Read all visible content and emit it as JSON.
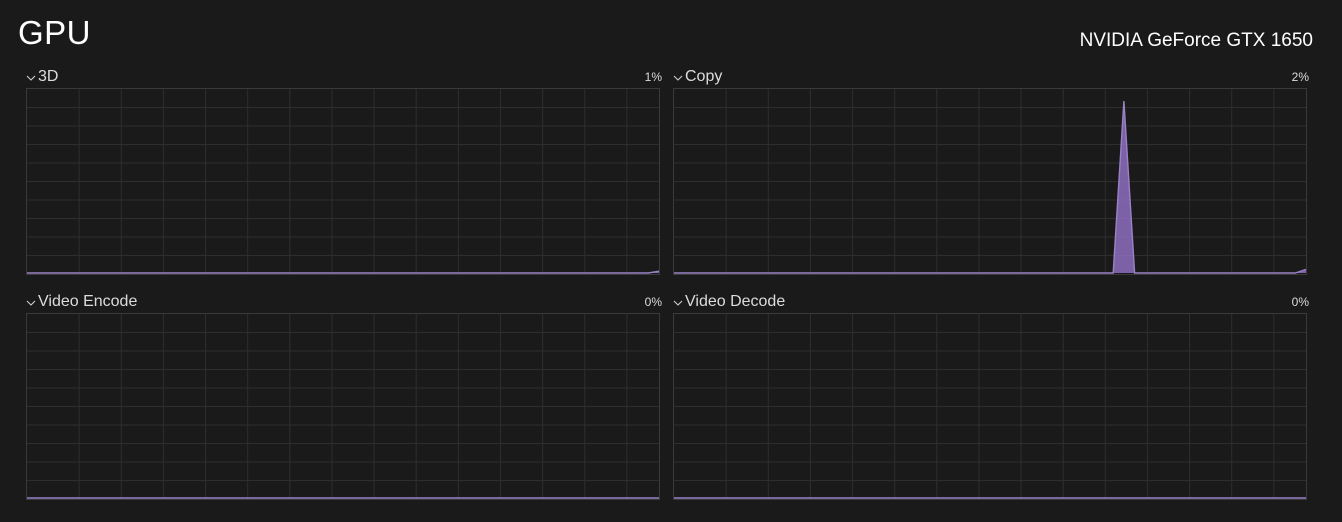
{
  "header": {
    "title": "GPU",
    "device_name": "NVIDIA GeForce GTX 1650"
  },
  "engines": [
    {
      "label": "3D",
      "value": "1%",
      "utilization": [
        0,
        0,
        0,
        0,
        0,
        0,
        0,
        0,
        0,
        0,
        0,
        0,
        0,
        0,
        0,
        0,
        0,
        0,
        0,
        0,
        0,
        0,
        0,
        0,
        0,
        0,
        0,
        0,
        0,
        0,
        0,
        0,
        0,
        0,
        0,
        0,
        0,
        0,
        0,
        0,
        0,
        0,
        0,
        0,
        0,
        0,
        0,
        0,
        0,
        0,
        0,
        0,
        0,
        0,
        0,
        0,
        0,
        0,
        0,
        1
      ]
    },
    {
      "label": "Copy",
      "value": "2%",
      "utilization": [
        0,
        0,
        0,
        0,
        0,
        0,
        0,
        0,
        0,
        0,
        0,
        0,
        0,
        0,
        0,
        0,
        0,
        0,
        0,
        0,
        0,
        0,
        0,
        0,
        0,
        0,
        0,
        0,
        0,
        0,
        0,
        0,
        0,
        0,
        0,
        0,
        0,
        0,
        0,
        0,
        0,
        0,
        95,
        0,
        0,
        0,
        0,
        0,
        0,
        0,
        0,
        0,
        0,
        0,
        0,
        0,
        0,
        0,
        0,
        2
      ]
    },
    {
      "label": "Video Encode",
      "value": "0%",
      "utilization": [
        0,
        0,
        0,
        0,
        0,
        0,
        0,
        0,
        0,
        0,
        0,
        0,
        0,
        0,
        0,
        0,
        0,
        0,
        0,
        0,
        0,
        0,
        0,
        0,
        0,
        0,
        0,
        0,
        0,
        0,
        0,
        0,
        0,
        0,
        0,
        0,
        0,
        0,
        0,
        0,
        0,
        0,
        0,
        0,
        0,
        0,
        0,
        0,
        0,
        0,
        0,
        0,
        0,
        0,
        0,
        0,
        0,
        0,
        0,
        0
      ]
    },
    {
      "label": "Video Decode",
      "value": "0%",
      "utilization": [
        0,
        0,
        0,
        0,
        0,
        0,
        0,
        0,
        0,
        0,
        0,
        0,
        0,
        0,
        0,
        0,
        0,
        0,
        0,
        0,
        0,
        0,
        0,
        0,
        0,
        0,
        0,
        0,
        0,
        0,
        0,
        0,
        0,
        0,
        0,
        0,
        0,
        0,
        0,
        0,
        0,
        0,
        0,
        0,
        0,
        0,
        0,
        0,
        0,
        0,
        0,
        0,
        0,
        0,
        0,
        0,
        0,
        0,
        0,
        0
      ]
    }
  ],
  "colors": {
    "background": "#1b1a1a",
    "grid": "#2e2e2e",
    "border": "#3a3a3a",
    "line": "#9a82c8",
    "fill": "#8d6fc0"
  },
  "icons": {
    "expand": "chevron-down-icon"
  }
}
